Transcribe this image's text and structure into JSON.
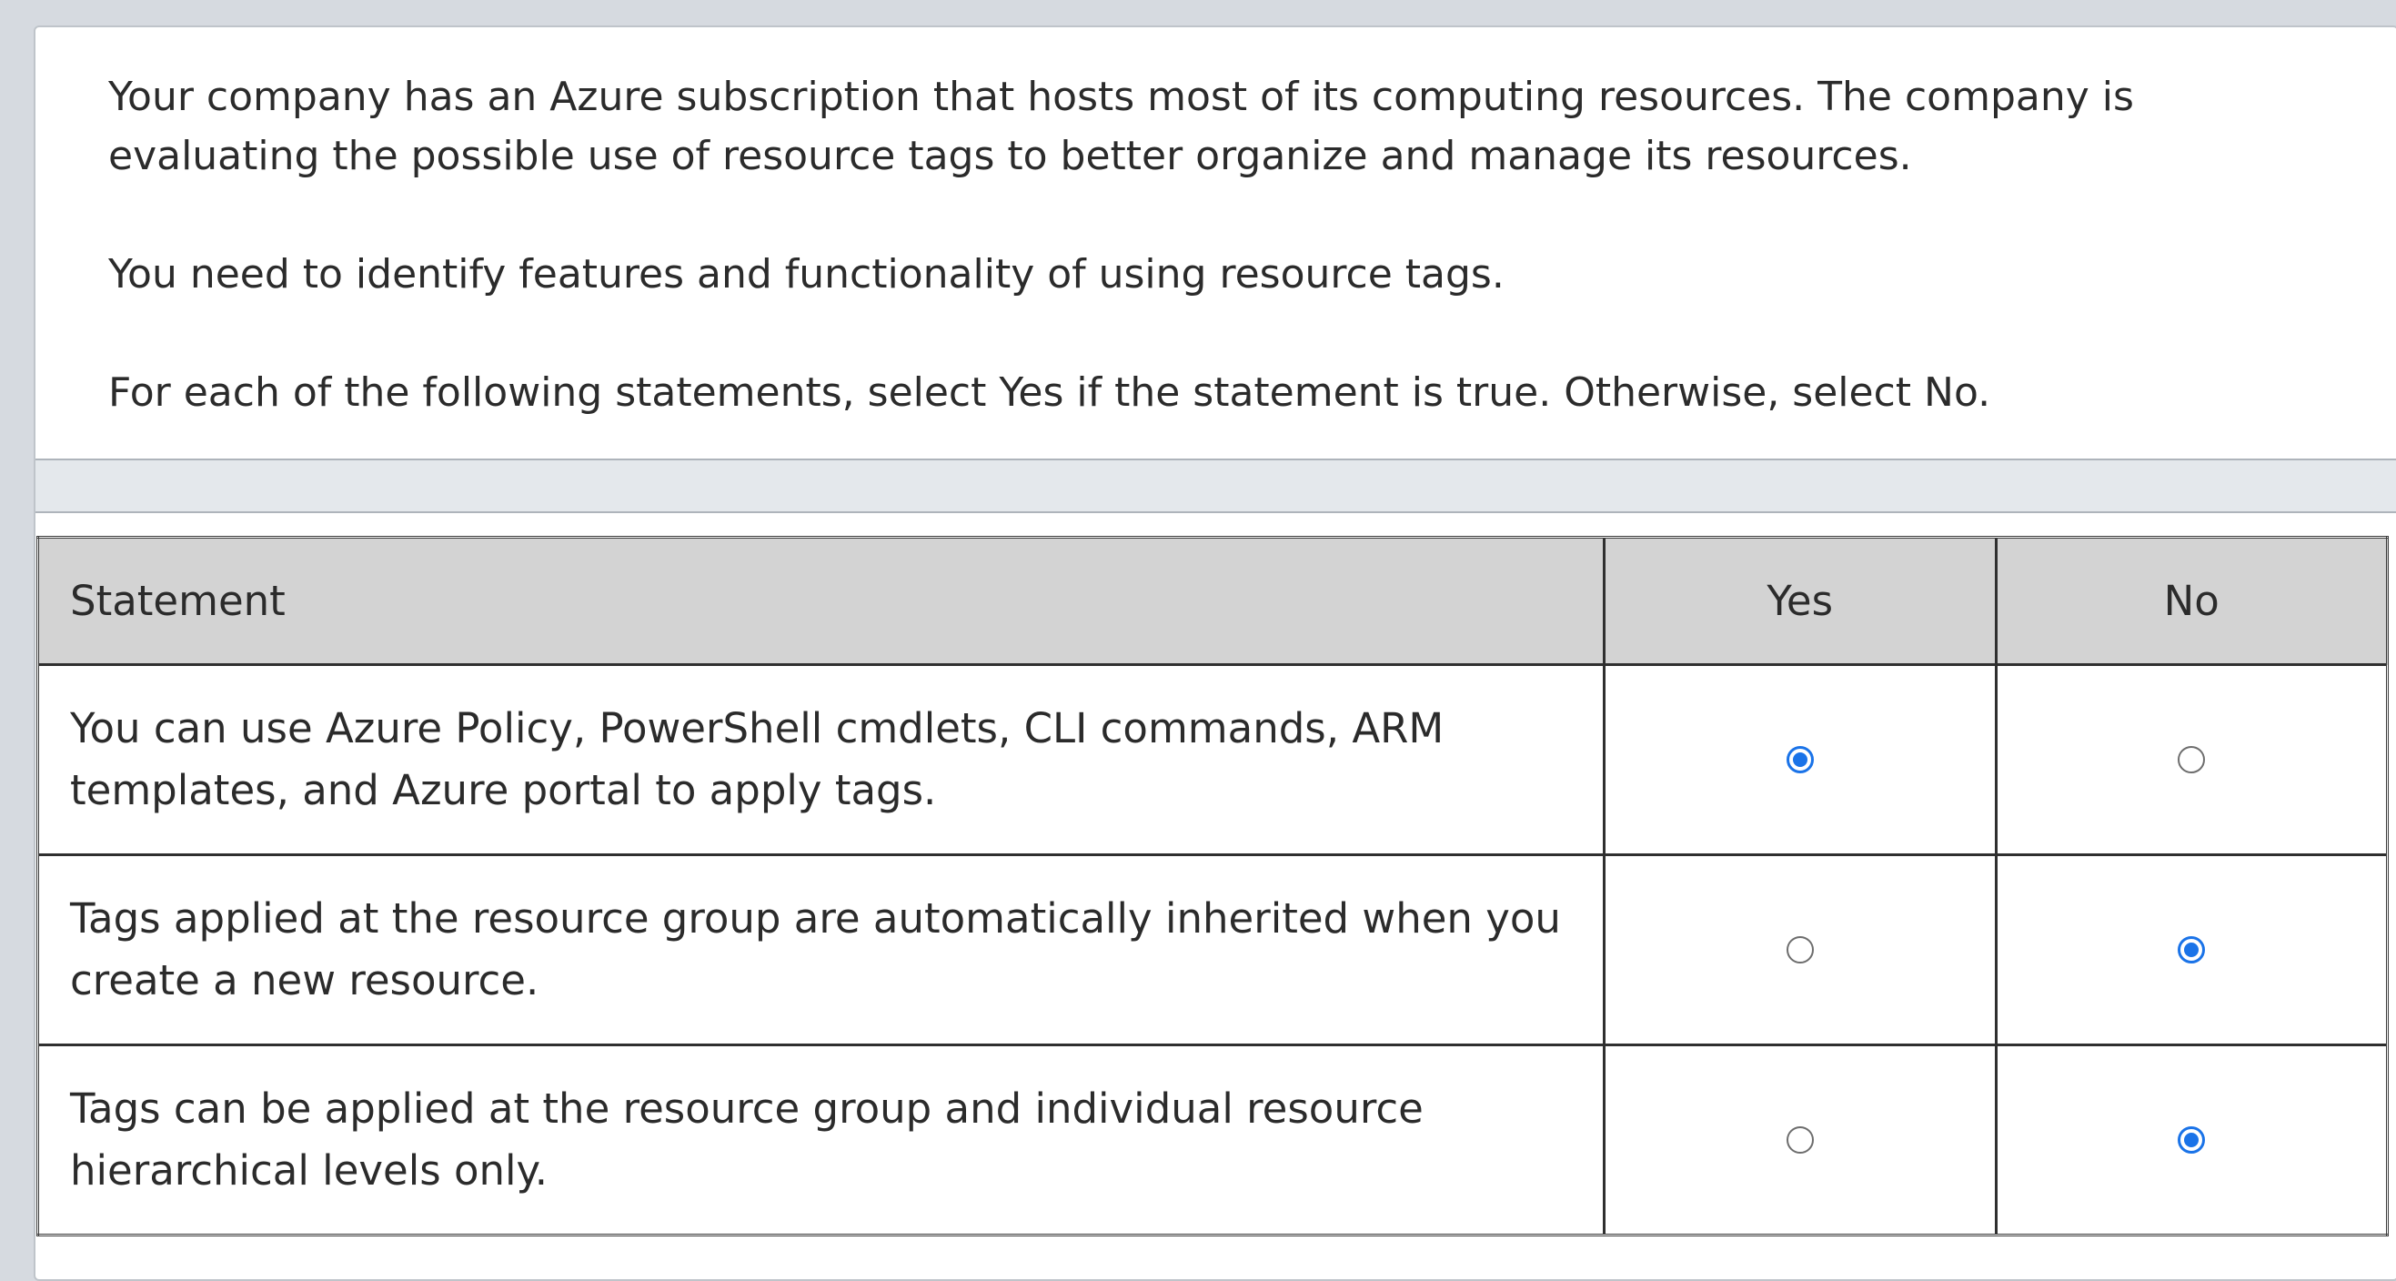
{
  "prompt": {
    "paragraphs": [
      "Your company has an Azure subscription that hosts most of its computing resources. The company is\nevaluating the possible use of resource tags to better organize and manage its resources.",
      "You need to identify features and functionality of using resource tags.",
      "For each of the following statements, select Yes if the statement is true. Otherwise, select No."
    ]
  },
  "table": {
    "headers": {
      "statement": "Statement",
      "yes": "Yes",
      "no": "No"
    },
    "rows": [
      {
        "statement": "You can use Azure Policy, PowerShell cmdlets, CLI commands, ARM\ntemplates, and Azure portal to apply tags.",
        "selected": "yes"
      },
      {
        "statement": "Tags applied at the resource group are automatically inherited when you\ncreate a new resource.",
        "selected": "no"
      },
      {
        "statement": "Tags can be applied at the resource group and individual resource\nhierarchical levels only.",
        "selected": "no"
      }
    ]
  },
  "colors": {
    "accent": "#1a73e8",
    "header_bg": "#d3d3d3",
    "page_bg": "#d6dae0"
  }
}
